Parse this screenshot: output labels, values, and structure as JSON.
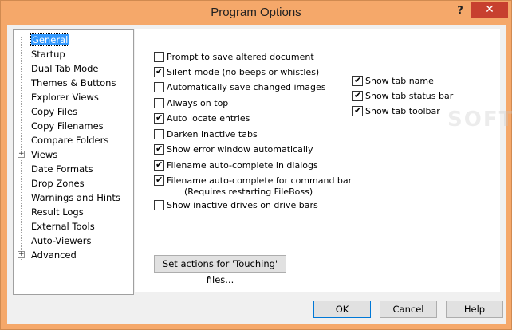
{
  "window": {
    "title": "Program Options",
    "help_symbol": "?",
    "close_symbol": "✕"
  },
  "tree": {
    "items": [
      {
        "label": "General",
        "selected": true,
        "expandable": false
      },
      {
        "label": "Startup",
        "expandable": false
      },
      {
        "label": "Dual Tab Mode",
        "expandable": false
      },
      {
        "label": "Themes & Buttons",
        "expandable": false
      },
      {
        "label": "Explorer Views",
        "expandable": false
      },
      {
        "label": "Copy Files",
        "expandable": false
      },
      {
        "label": "Copy Filenames",
        "expandable": false
      },
      {
        "label": "Compare Folders",
        "expandable": false
      },
      {
        "label": "Views",
        "expandable": true
      },
      {
        "label": "Date Formats",
        "expandable": false
      },
      {
        "label": "Drop Zones",
        "expandable": false
      },
      {
        "label": "Warnings and Hints",
        "expandable": false
      },
      {
        "label": "Result Logs",
        "expandable": false
      },
      {
        "label": "External Tools",
        "expandable": false
      },
      {
        "label": "Auto-Viewers",
        "expandable": false
      },
      {
        "label": "Advanced",
        "expandable": true
      }
    ],
    "expander_symbol": "+"
  },
  "left_options": [
    {
      "label": "Prompt to save altered document",
      "checked": false
    },
    {
      "label": "Silent mode (no beeps or whistles)",
      "checked": true
    },
    {
      "label": "Automatically save changed images",
      "checked": false
    },
    {
      "label": "Always on top",
      "checked": false
    },
    {
      "label": "Auto locate entries",
      "checked": true
    },
    {
      "label": "Darken inactive tabs",
      "checked": false
    },
    {
      "label": "Show error window automatically",
      "checked": true
    },
    {
      "label": "Filename auto-complete in dialogs",
      "checked": true
    },
    {
      "label": "Filename auto-complete for command bar",
      "sub": "(Requires restarting FileBoss)",
      "checked": true
    },
    {
      "label": "Show inactive drives on drive bars",
      "checked": false
    }
  ],
  "right_options": [
    {
      "label": "Show tab name",
      "checked": true
    },
    {
      "label": "Show tab status bar",
      "checked": true
    },
    {
      "label": "Show tab toolbar",
      "checked": true
    }
  ],
  "buttons": {
    "touching": "Set actions for 'Touching' files...",
    "ok": "OK",
    "cancel": "Cancel",
    "help": "Help"
  },
  "watermark": "SOFTPEDIA"
}
